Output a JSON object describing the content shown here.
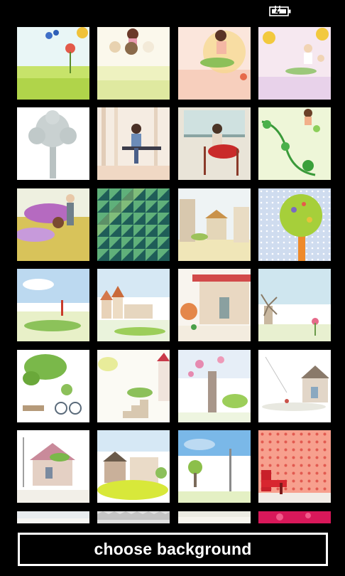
{
  "status_bar": {
    "battery_icon": "battery-charging-icon"
  },
  "wallpapers": [
    {
      "name": "wallpaper-flowers-meadow",
      "icon": "flower-meadow"
    },
    {
      "name": "wallpaper-kids-with-puppies",
      "icon": "children-puppies"
    },
    {
      "name": "wallpaper-girl-on-leaf",
      "icon": "girl-leaf"
    },
    {
      "name": "wallpaper-kids-sunflowers",
      "icon": "children-flowers"
    },
    {
      "name": "wallpaper-white-tree",
      "icon": "tree-silhouette"
    },
    {
      "name": "wallpaper-girl-on-bench",
      "icon": "girl-bench"
    },
    {
      "name": "wallpaper-girl-at-window",
      "icon": "girl-window"
    },
    {
      "name": "wallpaper-child-with-vines",
      "icon": "child-vines"
    },
    {
      "name": "wallpaper-flower-cart",
      "icon": "flower-cart"
    },
    {
      "name": "wallpaper-green-triangles",
      "icon": "triangle-pattern"
    },
    {
      "name": "wallpaper-old-town",
      "icon": "old-town"
    },
    {
      "name": "wallpaper-lollipop-tree",
      "icon": "lollipop-tree"
    },
    {
      "name": "wallpaper-blue-sky-landscape",
      "icon": "sky-landscape"
    },
    {
      "name": "wallpaper-castle-lake",
      "icon": "castle"
    },
    {
      "name": "wallpaper-cottage-flowers",
      "icon": "cottage"
    },
    {
      "name": "wallpaper-windmill-field",
      "icon": "windmill"
    },
    {
      "name": "wallpaper-bicycle-garden",
      "icon": "bicycle"
    },
    {
      "name": "wallpaper-garden-stairs",
      "icon": "stairs"
    },
    {
      "name": "wallpaper-blossom-tree",
      "icon": "blossom-tree"
    },
    {
      "name": "wallpaper-sketch-house",
      "icon": "sketch-house"
    },
    {
      "name": "wallpaper-village-house",
      "icon": "village-house"
    },
    {
      "name": "wallpaper-yellow-field-houses",
      "icon": "field-houses"
    },
    {
      "name": "wallpaper-street-lamp",
      "icon": "street-lamp"
    },
    {
      "name": "wallpaper-red-chair-hearts",
      "icon": "red-chair"
    },
    {
      "name": "wallpaper-pale-sketch",
      "icon": "pale-sketch"
    },
    {
      "name": "wallpaper-grey-pattern",
      "icon": "grey-pattern"
    },
    {
      "name": "wallpaper-pale-sky",
      "icon": "pale-sky"
    },
    {
      "name": "wallpaper-pink-dots",
      "icon": "pink-dots"
    }
  ],
  "actions": {
    "choose_background": "choose background"
  }
}
